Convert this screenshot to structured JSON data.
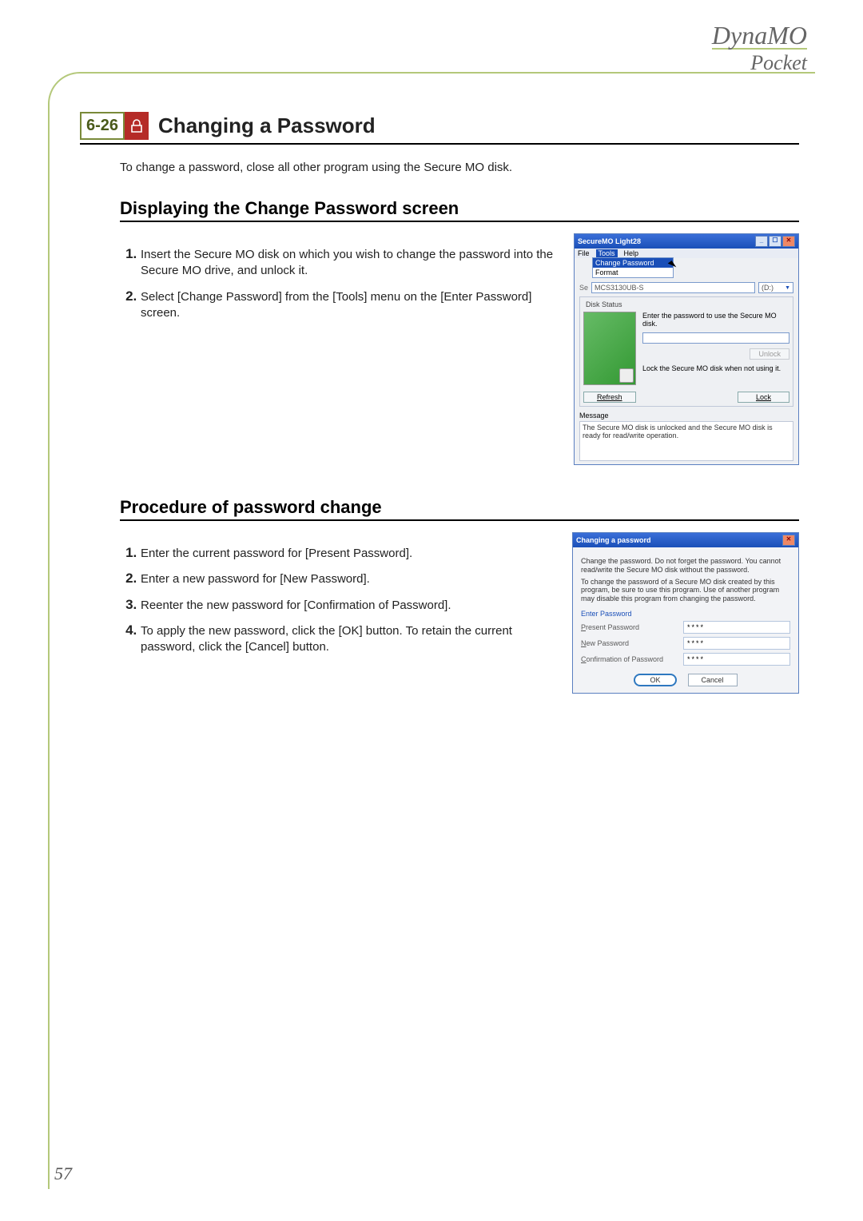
{
  "brand": {
    "title": "DynaMO",
    "sub": "Pocket"
  },
  "section": {
    "num": "6-26",
    "title": "Changing a Password"
  },
  "intro": "To change a password, close all other program using the Secure MO disk.",
  "sub1": "Displaying the Change Password screen",
  "steps1": [
    "Insert the Secure MO disk on which you wish to change the password into the Secure MO drive, and unlock it.",
    "Select [Change Password] from the [Tools] menu on the [Enter Password] screen."
  ],
  "win1": {
    "title": "SecureMO Light28",
    "menus": {
      "file": "File",
      "tools": "Tools",
      "help": "Help"
    },
    "tools_menu": {
      "change_pw": "Change Password",
      "format": "Format"
    },
    "drive_combo": "MCS3130UB-S",
    "drive_letter": "(D:)",
    "disk_status": "Disk Status",
    "prompt": "Enter the password to use the Secure MO disk.",
    "unlock": "Unlock",
    "lock_hint": "Lock the Secure MO disk when not using it.",
    "refresh": "Refresh",
    "lock": "Lock",
    "message_label": "Message",
    "message": "The Secure MO disk is unlocked and the Secure MO disk is ready for read/write operation."
  },
  "sub2": "Procedure of password change",
  "steps2": [
    "Enter the current password for [Present Password].",
    "Enter a new password for [New Password].",
    "Reenter the new password for [Confirmation of Password].",
    "To apply the new password, click the [OK] button. To retain the current password, click the [Cancel] button."
  ],
  "dlg": {
    "title": "Changing a password",
    "p1": "Change the password. Do not forget the password. You cannot read/write the Secure MO disk without the password.",
    "p2": "To change the password of a Secure MO disk created by this program, be sure to use this program. Use of another program may disable this program from changing the password.",
    "enter": "Enter Password",
    "present": "Present Password",
    "newpw": "New Password",
    "confirm": "Confirmation of Password",
    "mask": "****",
    "ok": "OK",
    "cancel": "Cancel"
  },
  "page": "57"
}
